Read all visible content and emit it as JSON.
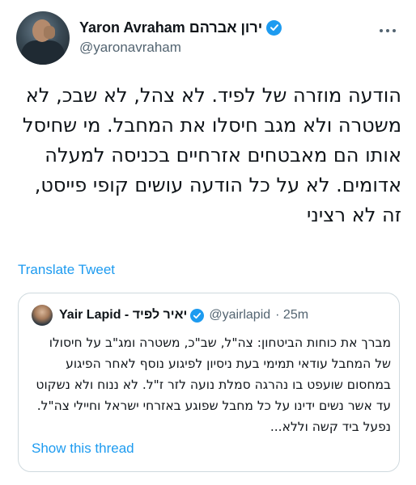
{
  "author": {
    "display_name": "Yaron Avraham ירון אברהם",
    "handle": "@yaronavraham"
  },
  "icons": {
    "verified": "verified-badge-icon",
    "more": "more-options-icon"
  },
  "colors": {
    "accent": "#1d9bf0",
    "secondary_text": "#536471",
    "border": "#cfd9de"
  },
  "tweet": {
    "text": "הודעה מוזרה של לפיד. לא צהל, לא שבכ, לא משטרה ולא מגב חיסלו את המחבל. מי שחיסל אותו הם מאבטחים אזרחיים בכניסה למעלה אדומים. לא על כל הודעה עושים קופי פייסט, זה לא רציני"
  },
  "translate_label": "Translate Tweet",
  "quoted_tweet": {
    "display_name": "Yair Lapid - יאיר לפיד",
    "handle": "@yairlapid",
    "time": "· 25m",
    "text": "מברך את כוחות הביטחון: צה\"ל, שב\"כ, משטרה ומג\"ב על חיסולו של המחבל עודאי תמימי בעת ניסיון לפיגוע נוסף לאחר הפיגוע במחסום שועפט בו נהרגה סמלת נועה לזר ז\"ל. לא ננוח ולא נשקוט עד אשר נשים ידינו על כל מחבל שפוגע באזרחי ישראל וחיילי צה\"ל. נפעל ביד קשה וללא...",
    "show_thread_label": "Show this thread"
  }
}
